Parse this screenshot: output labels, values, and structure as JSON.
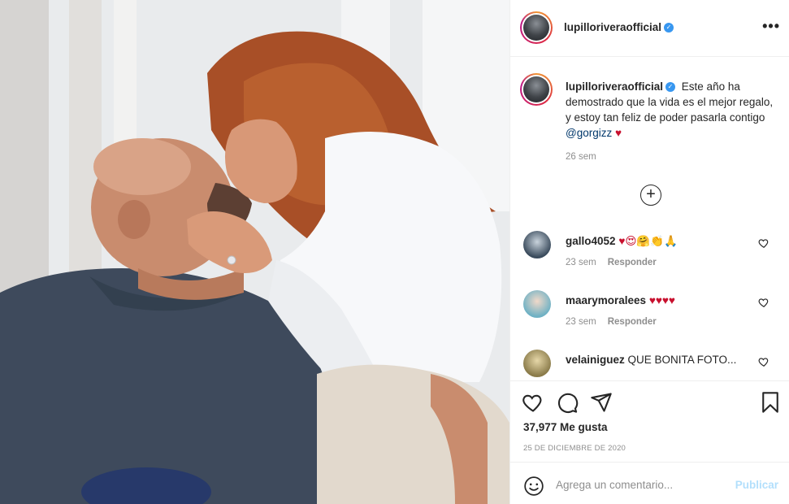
{
  "post": {
    "username": "lupilloriveraofficial",
    "verified_icon": "verified-badge-icon",
    "more_icon": "more-options-icon"
  },
  "caption": {
    "username": "lupilloriveraofficial",
    "text": "Este año ha demostrado que la vida es el mejor regalo, y estoy tan feliz de poder pasarla contigo",
    "mention": "@gorgizz",
    "heart": "♥",
    "time": "26 sem"
  },
  "load_more_icon": "plus-circle-icon",
  "comments": [
    {
      "username": "gallo4052",
      "text": "♥😍🤗👏🙏",
      "time": "23 sem",
      "reply": "Responder",
      "avatar_color": "#3a4b5c"
    },
    {
      "username": "maarymoralees",
      "text": "♥♥♥♥",
      "time": "23 sem",
      "reply": "Responder",
      "avatar_color": "#6fb1c4"
    },
    {
      "username": "velainiguez",
      "text": "QUE BONITA FOTO...",
      "time": "",
      "reply": "",
      "avatar_color": "#8a7b4a"
    }
  ],
  "actions": {
    "like_icon": "heart-icon",
    "comment_icon": "comment-icon",
    "share_icon": "share-icon",
    "save_icon": "bookmark-icon"
  },
  "likes_label": "37,977 Me gusta",
  "date": "25 DE DICIEMBRE DE 2020",
  "comment_bar": {
    "emoji_icon": "smiley-icon",
    "placeholder": "Agrega un comentario...",
    "publish": "Publicar"
  },
  "colors": {
    "accent": "#3897f0",
    "publish_disabled": "#b2dffc",
    "heart": "#c8102e"
  }
}
